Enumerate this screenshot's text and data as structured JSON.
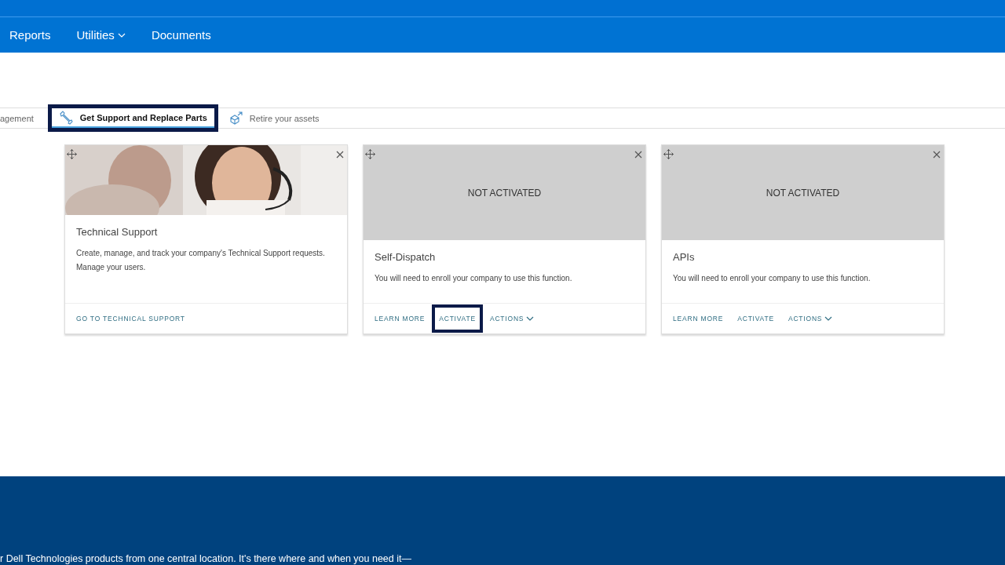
{
  "nav": [
    {
      "label": "Reports",
      "dropdown": false
    },
    {
      "label": "Utilities",
      "dropdown": true
    },
    {
      "label": "Documents",
      "dropdown": false
    }
  ],
  "tabs": [
    {
      "label": "agement",
      "selected": false
    },
    {
      "label": "Get Support and Replace Parts",
      "selected": true
    },
    {
      "label": "Retire your assets",
      "selected": false
    }
  ],
  "cards": [
    {
      "kind": "picture",
      "title": "Technical Support",
      "description": "Create, manage, and track your company's Technical Support requests. Manage your users.",
      "links": [
        {
          "label": "GO TO TECHNICAL SUPPORT",
          "dropdown": false,
          "highlighted": false
        }
      ]
    },
    {
      "kind": "status",
      "status": "NOT ACTIVATED",
      "title": "Self-Dispatch",
      "description": "You will need to enroll your company to use this function.",
      "links": [
        {
          "label": "LEARN MORE",
          "dropdown": false,
          "highlighted": false
        },
        {
          "label": "ACTIVATE",
          "dropdown": false,
          "highlighted": true
        },
        {
          "label": "ACTIONS",
          "dropdown": true,
          "highlighted": false
        }
      ]
    },
    {
      "kind": "status",
      "status": "NOT ACTIVATED",
      "title": "APIs",
      "description": "You will need to enroll your company to use this function.",
      "links": [
        {
          "label": "LEARN MORE",
          "dropdown": false,
          "highlighted": false
        },
        {
          "label": "ACTIVATE",
          "dropdown": false,
          "highlighted": false
        },
        {
          "label": "ACTIONS",
          "dropdown": true,
          "highlighted": false
        }
      ]
    }
  ],
  "footer": {
    "text": "r Dell Technologies products from one central location. It's there where and when you need it—"
  }
}
